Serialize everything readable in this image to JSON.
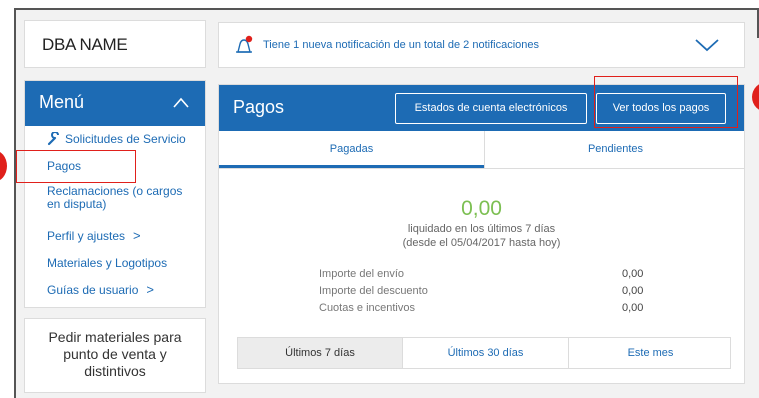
{
  "dba": {
    "name": "DBA NAME"
  },
  "menu": {
    "title": "Menú",
    "items": [
      {
        "label": "Solicitudes de Servicio"
      },
      {
        "label": "Pagos"
      },
      {
        "label": "Reclamaciones (o cargos en disputa)"
      },
      {
        "label": "Perfil y ajustes"
      },
      {
        "label": "Materiales y Logotipos"
      },
      {
        "label": "Guías de usuario"
      }
    ]
  },
  "order_box": {
    "label": "Pedir materiales para punto de venta y distintivos"
  },
  "notification": {
    "text": "Tiene 1 nueva notificación de un total de 2 notificaciones"
  },
  "pagos": {
    "title": "Pagos",
    "btn_estados": "Estados de cuenta electrónicos",
    "btn_ver": "Ver todos los pagos",
    "tabs": [
      {
        "label": "Pagadas"
      },
      {
        "label": "Pendientes"
      }
    ],
    "amount": "0,00",
    "period_line1": "liquidado en los últimos 7 días",
    "period_line2": "(desde el 05/04/2017 hasta hoy)",
    "rows": [
      {
        "label": "Importe del envío",
        "value": "0,00"
      },
      {
        "label": "Importe del descuento",
        "value": "0,00"
      },
      {
        "label": "Cuotas e incentivos",
        "value": "0,00"
      }
    ],
    "ranges": [
      {
        "label": "Últimos 7 días"
      },
      {
        "label": "Últimos 30 días"
      },
      {
        "label": "Este mes"
      }
    ]
  },
  "colors": {
    "brand_blue": "#1d6bb4",
    "amount_green": "#7cbf52",
    "highlight_red": "#e0201b"
  }
}
